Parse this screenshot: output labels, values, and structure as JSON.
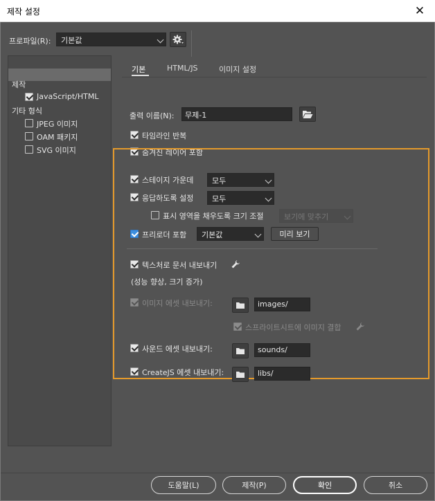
{
  "window": {
    "title": "제작 설정",
    "close_glyph": "✕"
  },
  "profile": {
    "label": "프로파일(R):",
    "value": "기본값"
  },
  "sidebar": {
    "section1": "제작",
    "item_js": "JavaScript/HTML",
    "section2": "기타 형식",
    "items": [
      "JPEG 이미지",
      "OAM 패키지",
      "SVG 이미지"
    ]
  },
  "tabs": [
    "기본",
    "HTML/JS",
    "이미지 설정"
  ],
  "basic": {
    "output_label": "출력 이름(N):",
    "output_value": "무제-1",
    "loop_timeline": "타임라인 반복",
    "include_hidden": "숨겨진 레이어 포함"
  },
  "stage": {
    "center_label": "스테이지 가운데",
    "center_value": "모두",
    "responsive_label": "응답하도록 설정",
    "responsive_value": "모두",
    "scale_label": "표시 영역을 채우도록 크기 조절",
    "scale_value": "보기에 맞추기",
    "preloader_label": "프리로더 포함",
    "preloader_value": "기본값",
    "preview_button": "미리 보기"
  },
  "export": {
    "texture_label": "텍스처로 문서 내보내기",
    "texture_note": "(성능 향상, 크기 증가)",
    "image_label": "이미지 에셋 내보내기:",
    "image_path": "images/",
    "sprite_label": "스프라이트시트에 이미지 결합",
    "sound_label": "사운드 에셋 내보내기:",
    "sound_path": "sounds/",
    "createjs_label": "CreateJS 에셋 내보내기:",
    "createjs_path": "libs/"
  },
  "footer": {
    "help": "도움말(L)",
    "publish": "제작(P)",
    "ok": "확인",
    "cancel": "취소"
  },
  "colors": {
    "accent_highlight": "#e59a2b",
    "checkbox_blue": "#3d8fe0",
    "panel": "#535353"
  },
  "icons": {
    "settings": "gear-icon",
    "folder": "folder-icon",
    "open_folder": "folder-open-icon",
    "wrench": "wrench-icon"
  }
}
